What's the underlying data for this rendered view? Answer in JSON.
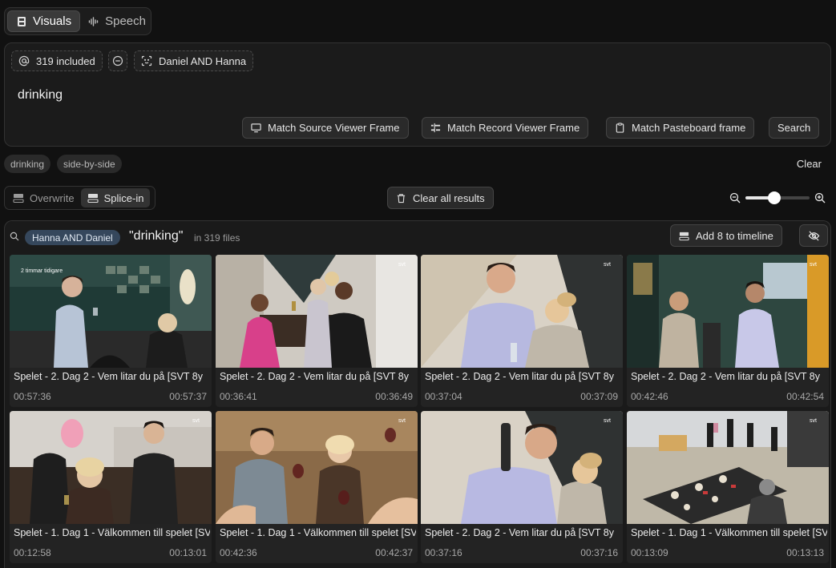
{
  "mode_tabs": [
    {
      "label": "Visuals",
      "icon": "film-icon",
      "active": true
    },
    {
      "label": "Speech",
      "icon": "waveform-icon",
      "active": false
    }
  ],
  "query": {
    "included_chip": "319 included",
    "people_chip": "Daniel AND Hanna",
    "text": "drinking",
    "buttons": {
      "match_source": "Match Source Viewer Frame",
      "match_record": "Match Record Viewer Frame",
      "match_pasteboard": "Match Pasteboard frame",
      "search": "Search"
    }
  },
  "tags": [
    "drinking",
    "side-by-side"
  ],
  "clear_label": "Clear",
  "edit_mode": {
    "overwrite": "Overwrite",
    "splice_in": "Splice-in",
    "active": "splice_in"
  },
  "clear_all_label": "Clear all results",
  "zoom": {
    "level": 0.45
  },
  "results": {
    "people": "Hanna AND Daniel",
    "query": "\"drinking\"",
    "count_text": "in 319 files",
    "add_label": "Add 8 to timeline",
    "items": [
      {
        "title": "Spelet - 2. Dag 2 - Vem litar du på [SVT 8y",
        "in": "00:57:36",
        "out": "00:57:37",
        "badge": "2 timmar tidigare"
      },
      {
        "title": "Spelet - 2. Dag 2 - Vem litar du på [SVT 8y",
        "in": "00:36:41",
        "out": "00:36:49",
        "badge": "svt"
      },
      {
        "title": "Spelet - 2. Dag 2 - Vem litar du på [SVT 8y",
        "in": "00:37:04",
        "out": "00:37:09",
        "badge": "svt"
      },
      {
        "title": "Spelet - 2. Dag 2 - Vem litar du på [SVT 8y",
        "in": "00:42:46",
        "out": "00:42:54",
        "badge": "svt"
      },
      {
        "title": "Spelet - 1. Dag 1 - Välkommen till spelet [SV",
        "in": "00:12:58",
        "out": "00:13:01",
        "badge": "svt"
      },
      {
        "title": "Spelet - 1. Dag 1 - Välkommen till spelet [SV",
        "in": "00:42:36",
        "out": "00:42:37",
        "badge": "svt"
      },
      {
        "title": "Spelet - 2. Dag 2 - Vem litar du på [SVT 8y",
        "in": "00:37:16",
        "out": "00:37:16",
        "badge": "svt"
      },
      {
        "title": "Spelet - 1. Dag 1 - Välkommen till spelet [SV",
        "in": "00:13:09",
        "out": "00:13:13",
        "badge": "svt"
      }
    ]
  }
}
